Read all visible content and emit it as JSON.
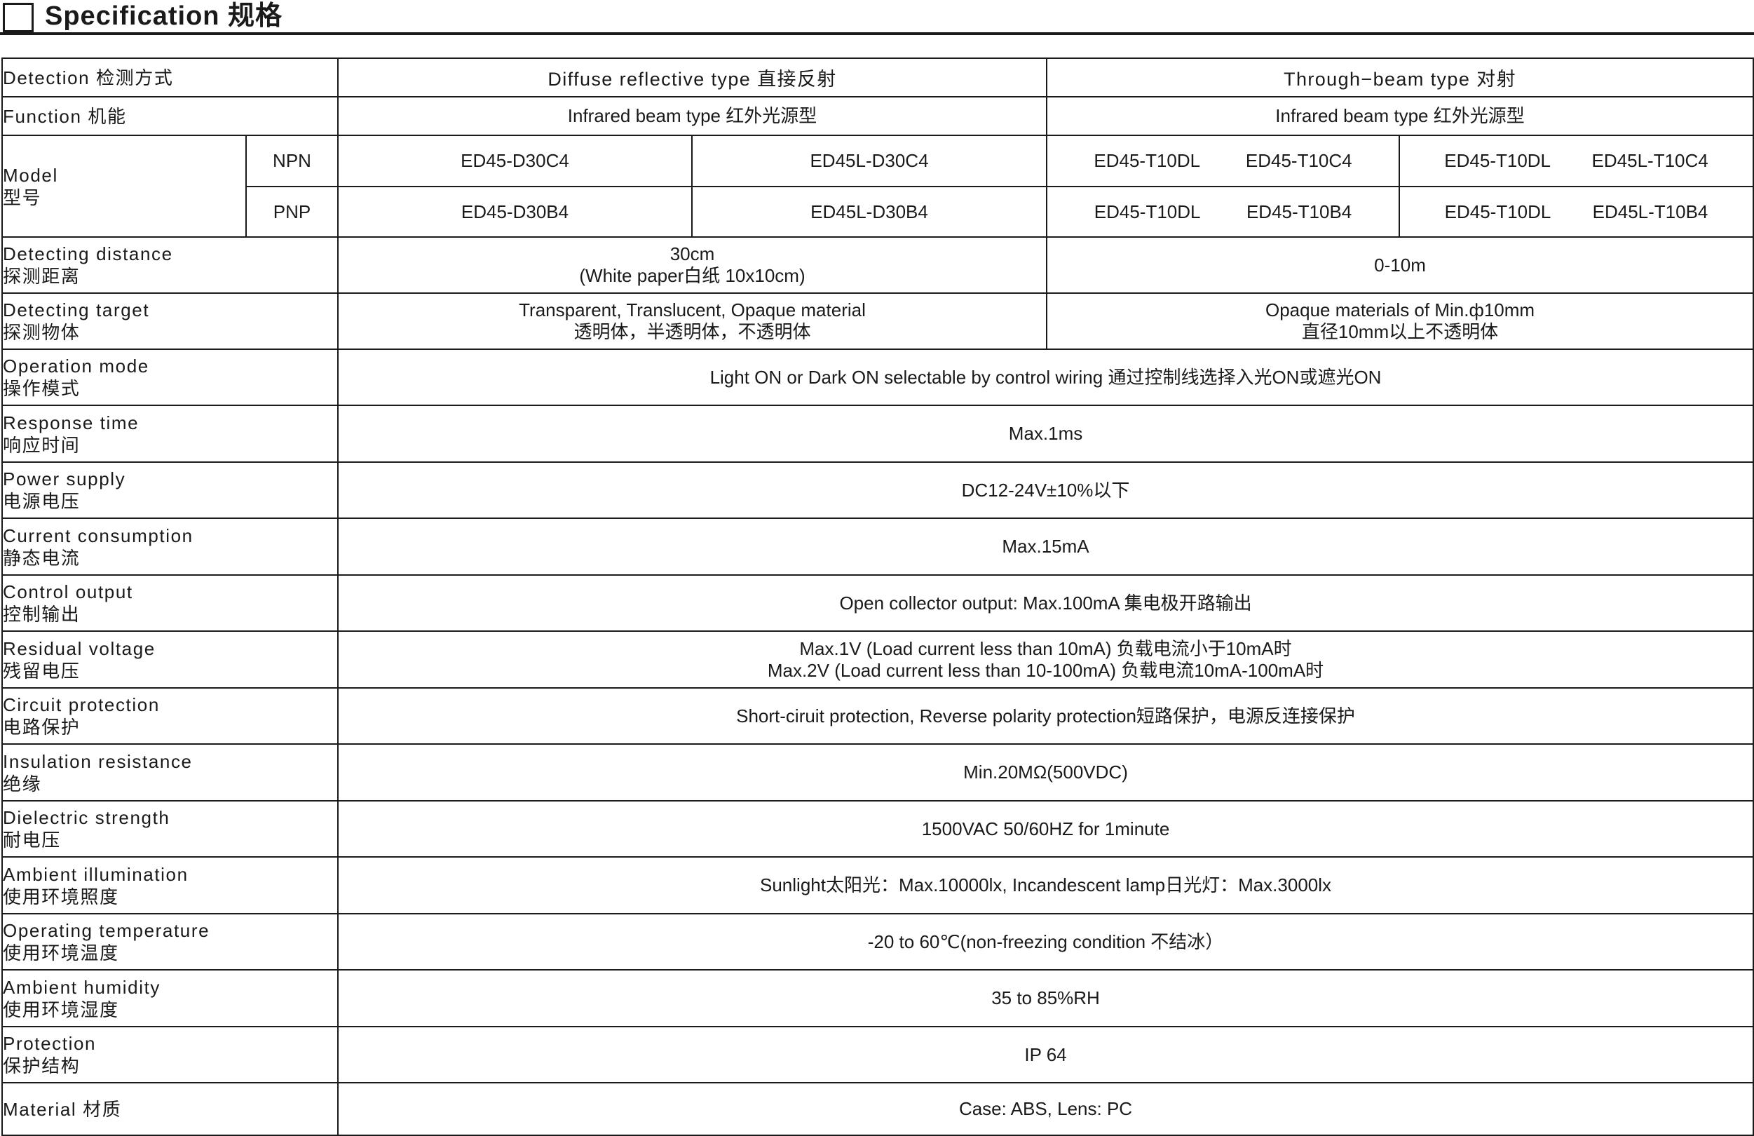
{
  "header": {
    "title": "Specification 规格"
  },
  "table": {
    "detection": {
      "label": "Detection 检测方式",
      "diffuse": "Diffuse reflective type  直接反射",
      "through": "Through−beam type  对射"
    },
    "function": {
      "label": "Function 机能",
      "diffuse": "Infrared beam type 红外光源型",
      "through": "Infrared beam type 红外光源型"
    },
    "model": {
      "label_en": "Model",
      "label_cn": "型号",
      "npn": {
        "label": "NPN",
        "d1": "ED45-D30C4",
        "d2": "ED45L-D30C4",
        "t1a": "ED45-T10DL",
        "t1b": "ED45-T10C4",
        "t2a": "ED45-T10DL",
        "t2b": "ED45L-T10C4"
      },
      "pnp": {
        "label": "PNP",
        "d1": "ED45-D30B4",
        "d2": "ED45L-D30B4",
        "t1a": "ED45-T10DL",
        "t1b": "ED45-T10B4",
        "t2a": "ED45-T10DL",
        "t2b": "ED45L-T10B4"
      }
    },
    "distance": {
      "en": "Detecting distance",
      "cn": "探测距离",
      "diffuse_1": "30cm",
      "diffuse_2": "(White paper白纸 10x10cm)",
      "through": "0-10m"
    },
    "target": {
      "en": "Detecting target",
      "cn": "探测物体",
      "diffuse_1": "Transparent, Translucent, Opaque material",
      "diffuse_2": "透明体，半透明体，不透明体",
      "through_1": "Opaque materials of Min.ф10mm",
      "through_2": "直径10mm以上不透明体"
    },
    "operation": {
      "en": "Operation mode",
      "cn": "操作模式",
      "value": "Light ON or Dark ON selectable by control wiring  通过控制线选择入光ON或遮光ON"
    },
    "response": {
      "en": "Response time",
      "cn": "响应时间",
      "value": "Max.1ms"
    },
    "power": {
      "en": "Power supply",
      "cn": "电源电压",
      "value": "DC12-24V±10%以下"
    },
    "current": {
      "en": "Current consumption",
      "cn": "静态电流",
      "value": "Max.15mA"
    },
    "control": {
      "en": "Control output",
      "cn": "控制输出",
      "value": "Open collector output: Max.100mA  集电极开路输出"
    },
    "residual": {
      "en": "Residual voltage",
      "cn": "残留电压",
      "value_1": "Max.1V  (Load current less than 10mA)  负载电流小于10mA时",
      "value_2": "Max.2V  (Load current less than 10-100mA)  负载电流10mA-100mA时"
    },
    "circuit": {
      "en": "Circuit protection",
      "cn": "电路保护",
      "value": "Short-ciruit protection, Reverse polarity protection短路保护，电源反连接保护"
    },
    "insulation": {
      "en": "Insulation resistance",
      "cn": "绝缘",
      "value": "Min.20MΩ(500VDC)"
    },
    "dielectric": {
      "en": "Dielectric strength",
      "cn": "耐电压",
      "value": "1500VAC 50/60HZ for 1minute"
    },
    "illumination": {
      "en": "Ambient illumination",
      "cn": "使用环境照度",
      "value": "Sunlight太阳光：Max.10000lx, Incandescent lamp日光灯：Max.3000lx"
    },
    "temperature": {
      "en": "Operating temperature",
      "cn": "使用环境温度",
      "value": "-20 to 60℃(non-freezing condition 不结冰）"
    },
    "humidity": {
      "en": "Ambient humidity",
      "cn": "使用环境湿度",
      "value": "35 to 85%RH"
    },
    "protection": {
      "en": "Protection",
      "cn": "保护结构",
      "value": "IP 64"
    },
    "material": {
      "label": "Material 材质",
      "value": "Case: ABS, Lens: PC"
    }
  }
}
